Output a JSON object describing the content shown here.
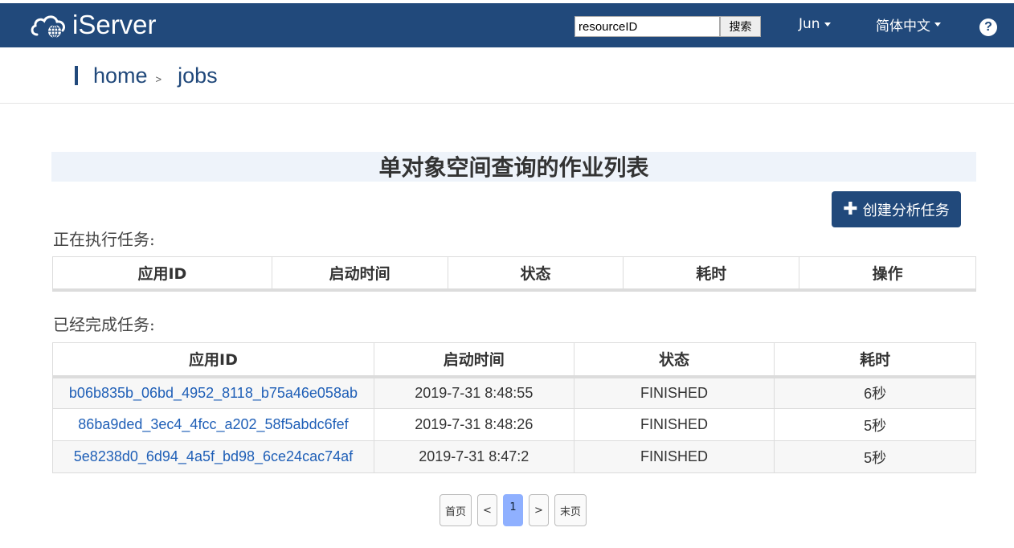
{
  "header": {
    "logo_text": "iServer",
    "search": {
      "value": "resourceID",
      "button_label": "搜索"
    },
    "user_label": "Jun",
    "language_label": "简体中文",
    "help_glyph": "?",
    "bg_color": "#21497b"
  },
  "breadcrumb": {
    "home": "home",
    "separator": ">",
    "current": "jobs"
  },
  "page": {
    "title": "单对象空间查询的作业列表",
    "create_button_label": "创建分析任务",
    "create_button_icon": "plus-icon"
  },
  "running": {
    "label": "正在执行任务:",
    "columns": [
      "应用ID",
      "启动时间",
      "状态",
      "耗时",
      "操作"
    ]
  },
  "finished": {
    "label": "已经完成任务:",
    "columns": [
      "应用ID",
      "启动时间",
      "状态",
      "耗时"
    ],
    "rows": [
      {
        "id": "b06b835b_06bd_4952_8118_b75a46e058ab",
        "start": "2019-7-31 8:48:55",
        "status": "FINISHED",
        "elapsed": "6秒"
      },
      {
        "id": "86ba9ded_3ec4_4fcc_a202_58f5abdc6fef",
        "start": "2019-7-31 8:48:26",
        "status": "FINISHED",
        "elapsed": "5秒"
      },
      {
        "id": "5e8238d0_6d94_4a5f_bd98_6ce24cac74af",
        "start": "2019-7-31 8:47:2",
        "status": "FINISHED",
        "elapsed": "5秒"
      }
    ]
  },
  "pagination": {
    "first": "首页",
    "prev": "<",
    "current": "1",
    "next": ">",
    "last": "末页"
  }
}
